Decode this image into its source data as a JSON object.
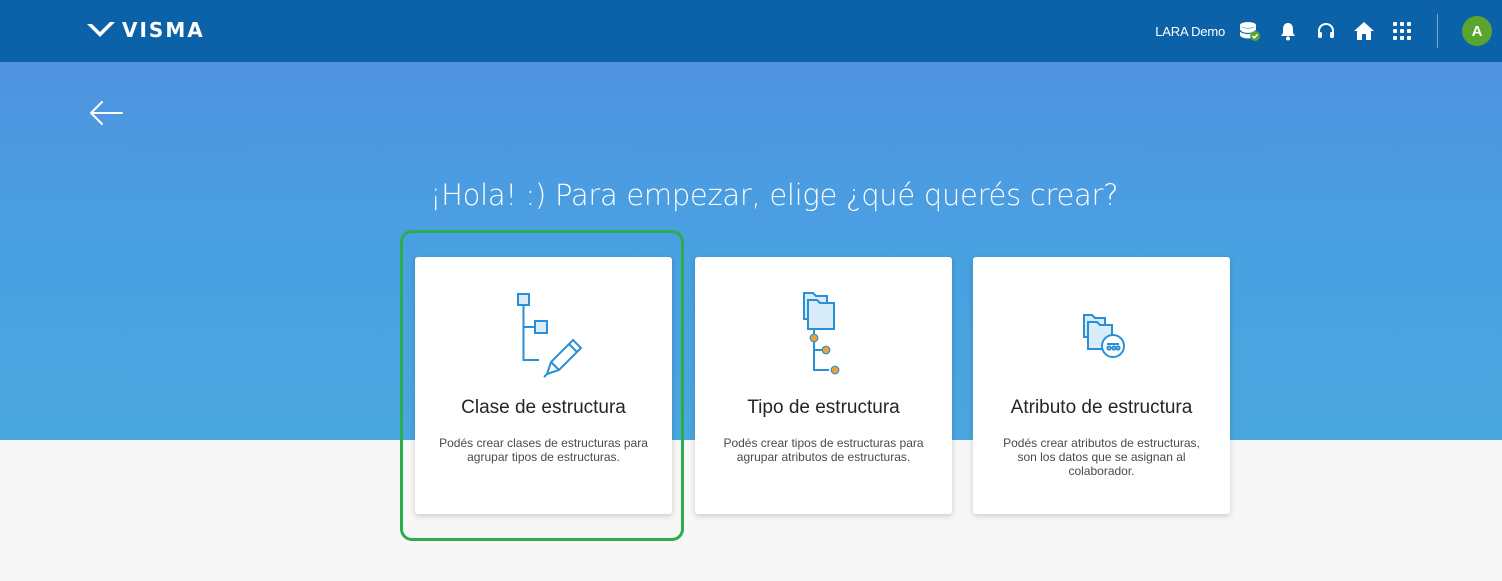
{
  "header": {
    "brand": "VISMA",
    "company": "LARA Demo",
    "avatar_initial": "A",
    "icons": [
      "database-check-icon",
      "bell-icon",
      "headset-icon",
      "home-icon",
      "apps-grid-icon"
    ]
  },
  "main": {
    "headline": "¡Hola! :) Para empezar, elige ¿qué querés crear?",
    "cards": [
      {
        "title": "Clase de estructura",
        "description": "Podés crear clases de estructuras para agrupar tipos de estructuras.",
        "icon": "tree-pencil-icon"
      },
      {
        "title": "Tipo de estructura",
        "description": "Podés crear tipos de estructuras para agrupar atributos de estructuras.",
        "icon": "folder-tree-icon"
      },
      {
        "title": "Atributo de estructura",
        "description": "Podés crear atributos de estructuras, son los datos que se asignan al colaborador.",
        "icon": "folder-attribute-icon"
      }
    ],
    "selected_card": 0
  },
  "colors": {
    "topbar": "#0c62a8",
    "hero": "#4a9ee1",
    "accent_icon": "#2b8fd6",
    "dot": "#f0a32c",
    "highlight": "#2dac4b",
    "avatar": "#5aa530"
  }
}
